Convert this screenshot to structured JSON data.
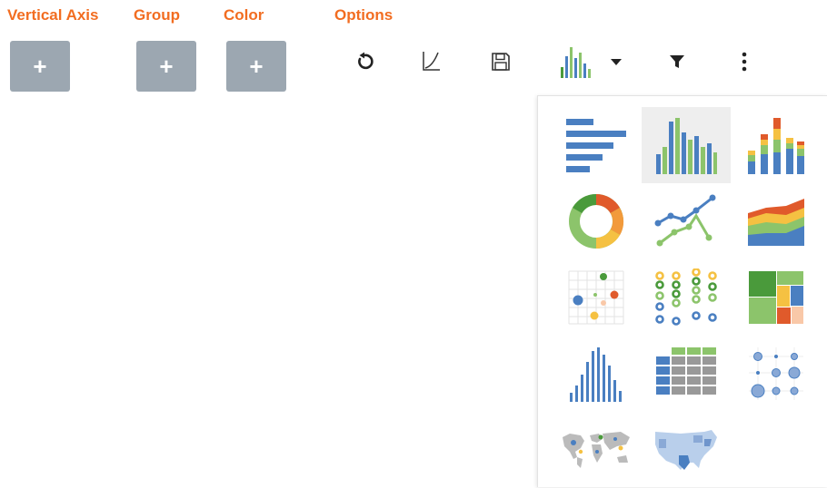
{
  "sections": {
    "vertical_axis": "Vertical Axis",
    "group": "Group",
    "color": "Color",
    "options": "Options"
  },
  "add_button_label": "+",
  "colors": {
    "accent": "#f26d21",
    "button_bg": "#9ca7b1",
    "blue": "#4a7fc1",
    "green": "#8cc46b",
    "dark_green": "#4a9a3b",
    "yellow": "#f5c142",
    "red": "#e05a2b",
    "orange": "#f29a3b",
    "gray": "#999999"
  },
  "toolbar": {
    "icons": [
      "undo-icon",
      "curve-icon",
      "save-icon",
      "chart-type-icon",
      "filter-icon",
      "more-vertical-icon"
    ]
  },
  "chart_type_menu": {
    "selected": "vertical-bar",
    "items": [
      {
        "id": "horizontal-bar",
        "icon": "horizontal-bar-chart-icon"
      },
      {
        "id": "vertical-bar",
        "icon": "vertical-bar-chart-icon"
      },
      {
        "id": "stacked-bar",
        "icon": "stacked-bar-chart-icon"
      },
      {
        "id": "donut",
        "icon": "donut-chart-icon"
      },
      {
        "id": "line",
        "icon": "line-chart-icon"
      },
      {
        "id": "area",
        "icon": "area-chart-icon"
      },
      {
        "id": "scatter",
        "icon": "scatter-plot-icon"
      },
      {
        "id": "dot-grid",
        "icon": "dot-plot-icon"
      },
      {
        "id": "treemap",
        "icon": "treemap-icon"
      },
      {
        "id": "histogram",
        "icon": "histogram-icon"
      },
      {
        "id": "table",
        "icon": "table-icon"
      },
      {
        "id": "bubble-grid",
        "icon": "bubble-grid-icon"
      },
      {
        "id": "world-map",
        "icon": "world-map-icon"
      },
      {
        "id": "us-map",
        "icon": "us-map-icon"
      }
    ]
  }
}
